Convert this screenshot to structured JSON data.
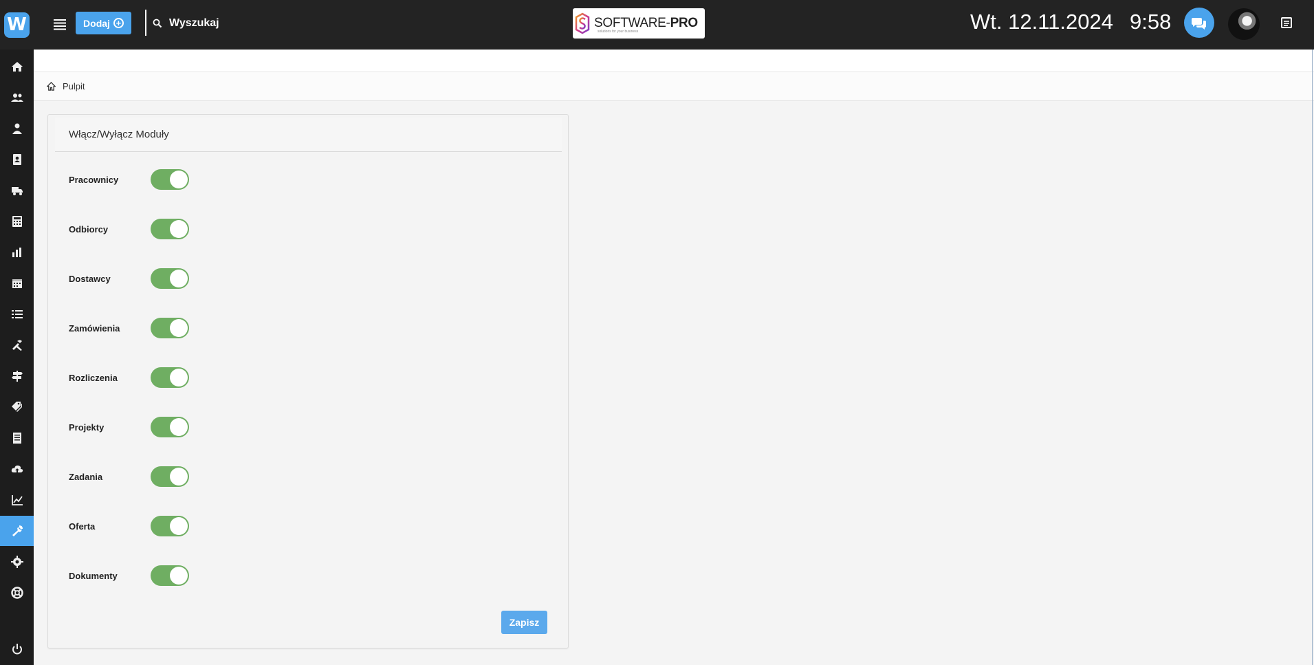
{
  "app": {
    "logo_letter": "W",
    "brand_color": "#4aa3ec"
  },
  "topbar": {
    "add_label": "Dodaj",
    "search_label": "Wyszukaj",
    "company": {
      "name_light": "SOFTWARE-",
      "name_bold": "PRO",
      "tagline": "solutions for your business"
    },
    "date": "Wt. 12.11.2024",
    "time": "9:58"
  },
  "sidebar": {
    "items": [
      {
        "icon": "home-icon"
      },
      {
        "icon": "users-icon"
      },
      {
        "icon": "user-tie-icon"
      },
      {
        "icon": "address-book-icon"
      },
      {
        "icon": "truck-icon"
      },
      {
        "icon": "calculator-icon"
      },
      {
        "icon": "bar-chart-icon"
      },
      {
        "icon": "calendar-icon"
      },
      {
        "icon": "list-icon"
      },
      {
        "icon": "tools-icon"
      },
      {
        "icon": "signpost-icon"
      },
      {
        "icon": "tags-icon"
      },
      {
        "icon": "document-icon"
      },
      {
        "icon": "cloud-upload-icon"
      },
      {
        "icon": "line-chart-icon"
      },
      {
        "icon": "wrench-icon",
        "active": true
      },
      {
        "icon": "gear-icon"
      },
      {
        "icon": "lifebuoy-icon"
      },
      {
        "icon": "power-icon"
      }
    ]
  },
  "breadcrumb": {
    "label": "Pulpit"
  },
  "modules_card": {
    "title": "Włącz/Wyłącz Moduły",
    "modules": [
      {
        "label": "Pracownicy",
        "enabled": true
      },
      {
        "label": "Odbiorcy",
        "enabled": true
      },
      {
        "label": "Dostawcy",
        "enabled": true
      },
      {
        "label": "Zamówienia",
        "enabled": true
      },
      {
        "label": "Rozliczenia",
        "enabled": true
      },
      {
        "label": "Projekty",
        "enabled": true
      },
      {
        "label": "Zadania",
        "enabled": true
      },
      {
        "label": "Oferta",
        "enabled": true
      },
      {
        "label": "Dokumenty",
        "enabled": true
      }
    ],
    "save_label": "Zapisz"
  }
}
